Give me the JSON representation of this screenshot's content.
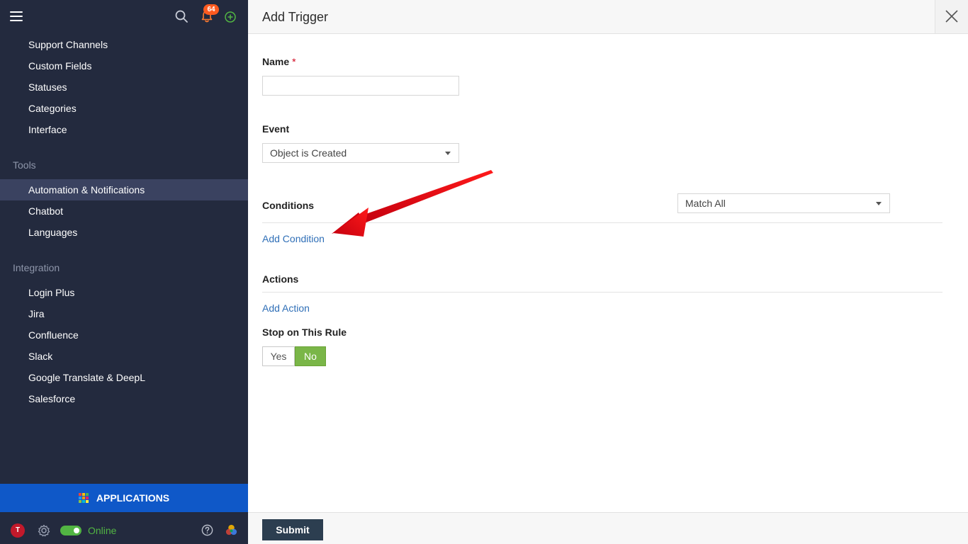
{
  "sidebar": {
    "notifications_count": "64",
    "settings_items": [
      {
        "label": "Support Channels"
      },
      {
        "label": "Custom Fields"
      },
      {
        "label": "Statuses"
      },
      {
        "label": "Categories"
      },
      {
        "label": "Interface"
      }
    ],
    "tools_heading": "Tools",
    "tools_items": [
      {
        "label": "Automation & Notifications",
        "active": true
      },
      {
        "label": "Chatbot"
      },
      {
        "label": "Languages"
      }
    ],
    "integration_heading": "Integration",
    "integration_items": [
      {
        "label": "Login Plus"
      },
      {
        "label": "Jira"
      },
      {
        "label": "Confluence"
      },
      {
        "label": "Slack"
      },
      {
        "label": "Google Translate & DeepL"
      },
      {
        "label": "Salesforce"
      }
    ],
    "applications_label": "APPLICATIONS",
    "user_initial": "T",
    "status_label": "Online"
  },
  "form": {
    "title": "Add Trigger",
    "name_label": "Name",
    "required_marker": "*",
    "name_value": "",
    "event_label": "Event",
    "event_value": "Object is Created",
    "conditions_label": "Conditions",
    "match_value": "Match All",
    "add_condition": "Add Condition",
    "actions_label": "Actions",
    "add_action": "Add Action",
    "stop_label": "Stop on This Rule",
    "stop_yes": "Yes",
    "stop_no": "No",
    "stop_selected": "No",
    "submit_label": "Submit"
  },
  "colors": {
    "sidebar_bg": "#232a3e",
    "active_item_bg": "#3a4260",
    "applications_bg": "#0f58c8",
    "badge": "#ff5a1f",
    "online": "#52b543",
    "link": "#2f6fb7",
    "toggle_selected": "#7ab648",
    "submit_bg": "#2c3e50",
    "annotation_arrow": "#e30613"
  },
  "icons": {
    "menu": "hamburger-icon",
    "search": "search-icon",
    "notifications": "bell-icon",
    "create": "plus-circle-icon",
    "apps": "grid-icon",
    "settings": "gear-icon",
    "help": "help-circle-icon",
    "close": "close-icon",
    "dropdown": "caret-down-icon"
  }
}
